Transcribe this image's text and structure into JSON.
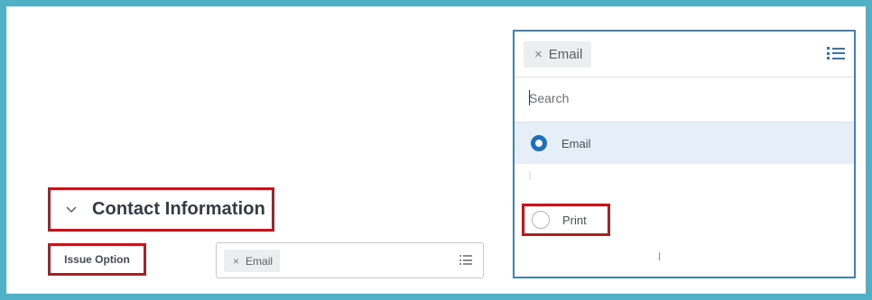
{
  "section": {
    "chevron": "chevron-down-icon",
    "title": "Contact Information"
  },
  "field": {
    "label": "Issue Option",
    "selected_pill": "Email",
    "remove_icon": "×",
    "list_icon": "list-icon"
  },
  "dropdown": {
    "selected_pill": "Email",
    "remove_icon": "×",
    "list_icon": "list-icon",
    "search_placeholder": "Search",
    "options": [
      {
        "label": "Email",
        "selected": true
      },
      {
        "label": "Print",
        "selected": false
      }
    ]
  },
  "colors": {
    "frame": "#4fb0c6",
    "highlight_box": "#c0161e",
    "accent": "#1f6fbf",
    "selected_row": "#e6eff7"
  }
}
